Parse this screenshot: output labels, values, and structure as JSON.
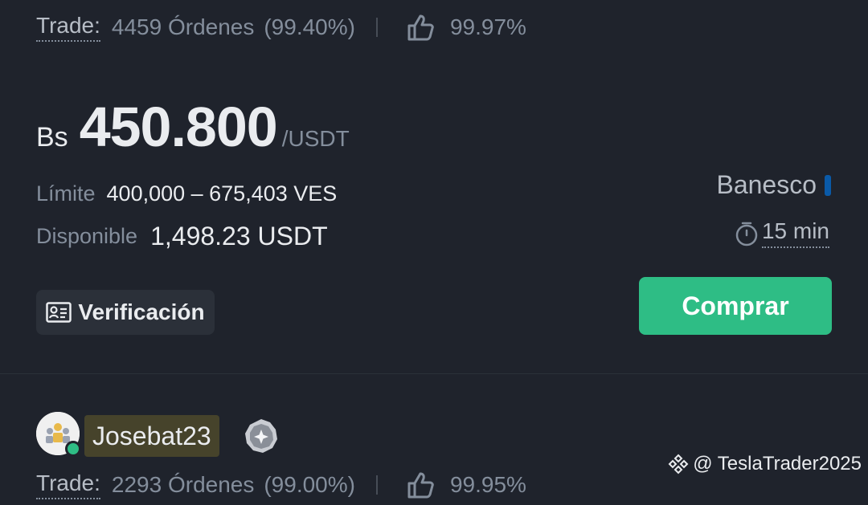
{
  "listing": {
    "trade_label": "Trade:",
    "orders": "4459 Órdenes",
    "completion": "(99.40%)",
    "positive_rate": "99.97%",
    "currency_symbol": "Bs",
    "price": "450.800",
    "price_unit": "/USDT",
    "limit_label": "Límite",
    "limit_value": "400,000 – 675,403 VES",
    "available_label": "Disponible",
    "available_value": "1,498.23 USDT",
    "payment_method": "Banesco",
    "payment_color": "#0a5aa8",
    "time_limit": "15 min",
    "verification_label": "Verificación",
    "buy_label": "Comprar",
    "buy_color": "#2ebd85"
  },
  "next_listing": {
    "username": "Josebat23",
    "trade_label": "Trade:",
    "orders": "2293 Órdenes",
    "completion": "(99.00%)",
    "positive_rate": "99.95%"
  },
  "watermark": {
    "text": "@ TeslaTrader2025"
  }
}
